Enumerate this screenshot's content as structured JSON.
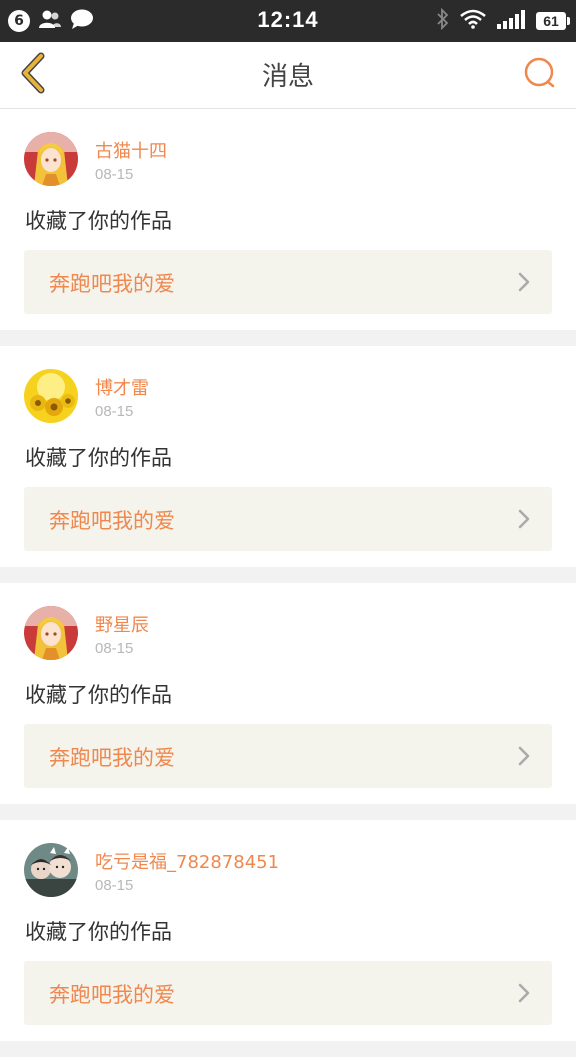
{
  "status_bar": {
    "notification_count": "6",
    "time": "12:14",
    "battery": "61"
  },
  "nav": {
    "title": "消息"
  },
  "colors": {
    "accent": "#f0884e",
    "back_arrow": "#e8b33a",
    "link_bg": "#f4f3ec"
  },
  "messages": [
    {
      "username": "古猫十四",
      "date": "08-15",
      "action": "收藏了你的作品",
      "work_title": "奔跑吧我的爱",
      "avatar_icon": "anime-girl-avatar"
    },
    {
      "username": "博才雷",
      "date": "08-15",
      "action": "收藏了你的作品",
      "work_title": "奔跑吧我的爱",
      "avatar_icon": "sunflower-avatar"
    },
    {
      "username": "野星辰",
      "date": "08-15",
      "action": "收藏了你的作品",
      "work_title": "奔跑吧我的爱",
      "avatar_icon": "anime-girl-avatar"
    },
    {
      "username": "吃亏是福_782878451",
      "date": "08-15",
      "action": "收藏了你的作品",
      "work_title": "奔跑吧我的爱",
      "avatar_icon": "kids-photo-avatar"
    }
  ]
}
